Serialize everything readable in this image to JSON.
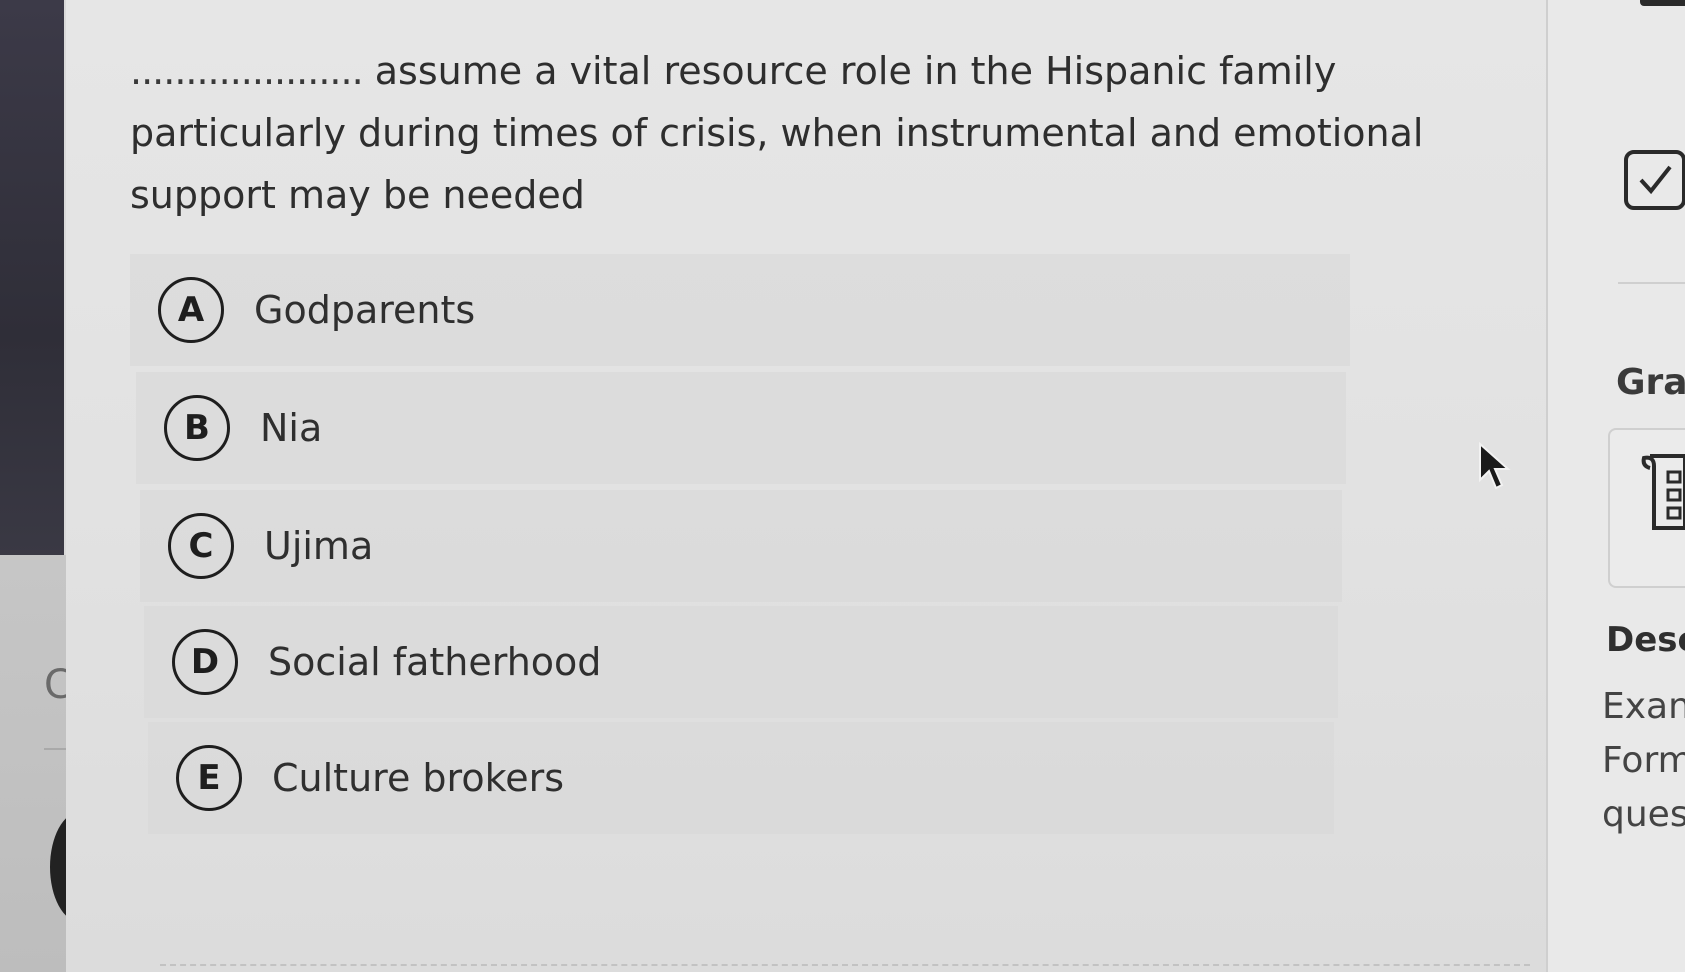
{
  "question": {
    "blank": ".....................",
    "text": "assume a vital resource role in the Hispanic family particularly during times of crisis, when instrumental and emotional support may be needed"
  },
  "options": [
    {
      "letter": "A",
      "label": "Godparents"
    },
    {
      "letter": "B",
      "label": "Nia"
    },
    {
      "letter": "C",
      "label": "Ujima"
    },
    {
      "letter": "D",
      "label": "Social fatherhood"
    },
    {
      "letter": "E",
      "label": "Culture brokers"
    }
  ],
  "left_sidebar": {
    "partial_letter": "C"
  },
  "right_panel": {
    "check_icon": "checkbox-checked-icon",
    "grade_heading": "Gra",
    "sheet_icon": "gradebook-sheet-icon",
    "description_heading": "Desc",
    "description_lines": [
      "Exan",
      "Form",
      "ques"
    ]
  },
  "colors": {
    "background": "#e4e4e4",
    "sidebar_dark": "#2f2e38",
    "text": "#2e2e2e",
    "option_circle": "#1e1e1e"
  }
}
